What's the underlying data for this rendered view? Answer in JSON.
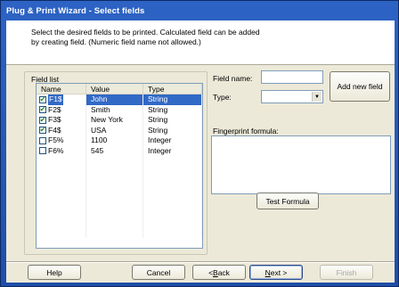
{
  "window": {
    "title": "Plug & Print Wizard - Select fields"
  },
  "header": {
    "description": "Select the desired fields to be printed. Calculated field can be added by creating field. (Numeric field name not allowed.)"
  },
  "field_list": {
    "group_label": "Field list",
    "columns": [
      "Name",
      "Value",
      "Type"
    ],
    "rows": [
      {
        "name": "F1$",
        "value": "John",
        "type": "String",
        "checked": true,
        "selected": true
      },
      {
        "name": "F2$",
        "value": "Smith",
        "type": "String",
        "checked": true,
        "selected": false
      },
      {
        "name": "F3$",
        "value": "New York",
        "type": "String",
        "checked": true,
        "selected": false
      },
      {
        "name": "F4$",
        "value": "USA",
        "type": "String",
        "checked": true,
        "selected": false
      },
      {
        "name": "F5%",
        "value": "1100",
        "type": "Integer",
        "checked": false,
        "selected": false
      },
      {
        "name": "F6%",
        "value": "545",
        "type": "Integer",
        "checked": false,
        "selected": false
      }
    ]
  },
  "field_editor": {
    "field_name_label": "Field name:",
    "field_name_value": "",
    "type_label": "Type:",
    "type_value": "",
    "add_button": "Add new field",
    "formula_label": "Fingerprint formula:",
    "formula_value": "",
    "test_button": "Test Formula"
  },
  "footer": {
    "help": "Help",
    "cancel": "Cancel",
    "back_prefix": "< ",
    "back_accel": "B",
    "back_rest": "ack",
    "next_accel": "N",
    "next_rest": "ext >",
    "finish": "Finish"
  },
  "colors": {
    "selection": "#3169c6",
    "titlebar": "#2d63c4",
    "dialog_bg": "#ece9d8",
    "check": "#1a8a1a"
  }
}
